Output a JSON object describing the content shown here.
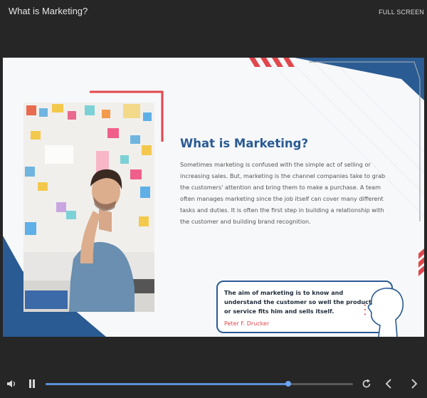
{
  "window": {
    "title": "What is Marketing?",
    "fullscreen_label": "FULL SCREEN"
  },
  "slide": {
    "heading": "What is Marketing?",
    "body": "Sometimes marketing is confused with the simple act of selling or increasing sales. But, marketing is the channel companies take to grab the customers' attention and bring them to make a purchase. A team often manages marketing since the job itself can cover many different tasks and duties. It is often the first step in building a relationship with the customer and building brand recognition.",
    "quote": {
      "text": "The aim of marketing is to know and understand the customer so well the product or service fits him and sells itself.",
      "author": "Peter F. Drucker"
    },
    "colors": {
      "accent_blue": "#2a5b93",
      "accent_red": "#e0474c"
    }
  },
  "player": {
    "progress": 0.79,
    "icons": [
      "volume-icon",
      "pause-icon",
      "replay-icon",
      "prev-icon",
      "next-icon"
    ]
  }
}
